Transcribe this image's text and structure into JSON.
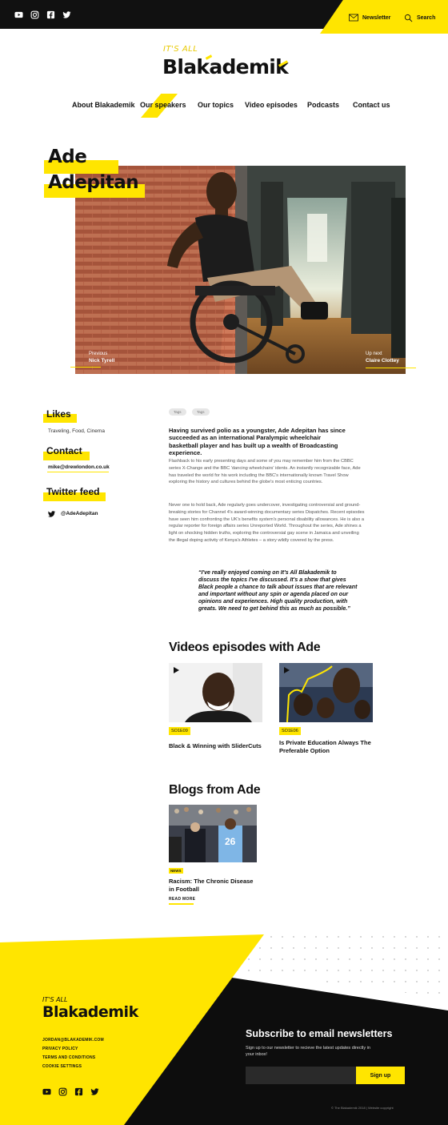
{
  "topbar": {
    "social_icons": [
      "youtube-icon",
      "instagram-icon",
      "facebook-icon",
      "twitter-icon"
    ],
    "newsletter_label": "Newsletter",
    "search_label": "Search"
  },
  "brand": {
    "tagline": "IT'S ALL",
    "name": "Blakademik",
    "accent_color": "#ffe500"
  },
  "nav": {
    "items": [
      "About Blakademik",
      "Our speakers",
      "Our topics",
      "Video episodes",
      "Podcasts",
      "Contact us"
    ],
    "active": "Our speakers"
  },
  "hero": {
    "first_name": "Ade",
    "last_name": "Adepitan",
    "previous_label": "Previous",
    "previous_name": "Nick Tyrell",
    "next_label": "Up next",
    "next_name": "Claire Clottey"
  },
  "sidebar": {
    "likes_heading": "Likes",
    "likes_text": "Traveling, Food, Cinema",
    "contact_heading": "Contact",
    "contact_email": "mike@drewlondon.co.uk",
    "twitter_heading": "Twitter feed",
    "twitter_handle": "@AdeAdepitan"
  },
  "article": {
    "tags": [
      "Tags",
      "Tags"
    ],
    "intro": "Having survived polio as a youngster, Ade Adepitan has since succeeded as an international Paralympic wheelchair basketball player and has built up a wealth of Broadcasting experience.",
    "paragraph_1": "Flashback to his early presenting days and some of you may remember him from the CBBC series X-Change and the BBC 'dancing wheelchairs' idents. An instantly recognizable face, Ade has traveled the world for his work including the BBC's internationally known Travel Show exploring the history and cultures behind the globe's most enticing countries.",
    "paragraph_2": "Never one to hold back, Ade regularly goes undercover, investigating controversial and ground-breaking stories for Channel 4's award-winning documentary series Dispatches. Recent episodes have seen him confronting the UK's benefits system's personal disability allowances. He is also a regular reporter for foreign affairs series Unreported World. Throughout the series, Ade shines a light on shocking hidden truths, exploring the controversial gay scene in Jamaica and unveiling the illegal doping activity of Kenya's Athletes – a story wildly covered by the press.",
    "quote": "“I've really enjoyed coming on It's All Blakademik to discuss the topics I've discussed. It's a show that gives Black people a chance to talk about issues that are relevant and important without any spin or agenda placed on our opinions and experiences. High quality production, with greats. We need to get behind this as much as possible.”"
  },
  "videos": {
    "heading": "Videos episodes with Ade",
    "items": [
      {
        "episode": "SO1E09",
        "title": "Black & Winning with SliderCuts"
      },
      {
        "episode": "SO1E06",
        "title": "Is Private Education Always The Preferable Option"
      }
    ]
  },
  "blogs": {
    "heading": "Blogs from Ade",
    "items": [
      {
        "badge": "NEWS",
        "title": "Racism: The Chronic Disease in Football",
        "cta": "READ MORE"
      }
    ]
  },
  "footer": {
    "tagline": "IT'S ALL",
    "name": "Blakademik",
    "links": [
      "JORDAN@BLAKADEMIK.COM",
      "PRIVACY POLICY",
      "TERMS AND CONDITIONS",
      "COOKIE SETTINGS"
    ],
    "social_icons": [
      "youtube-icon",
      "instagram-icon",
      "facebook-icon",
      "twitter-icon"
    ],
    "subscribe_heading": "Subscribe to email newsletters",
    "subscribe_text": "Sign up to our newsletter to recieve the latest updates directly in your inbox!",
    "email_placeholder": "",
    "signup_label": "Sign up",
    "copyright": "© The Blakademik 2018 | Website copyright"
  }
}
